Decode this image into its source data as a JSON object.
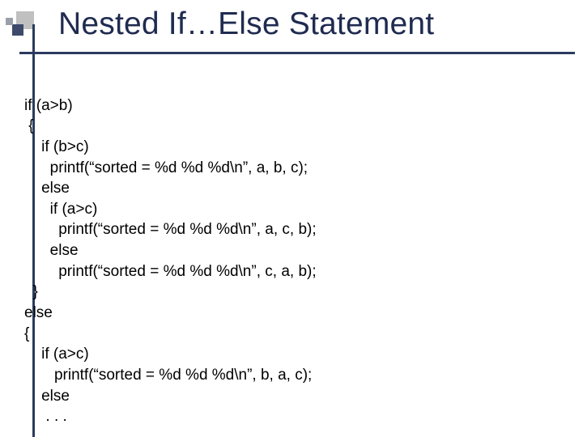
{
  "slide": {
    "title": "Nested If…Else Statement"
  },
  "code": {
    "lines": [
      "if (a>b)",
      " {",
      "    if (b>c)",
      "      printf(“sorted = %d %d %d\\n”, a, b, c);",
      "    else",
      "      if (a>c)",
      "        printf(“sorted = %d %d %d\\n”, a, c, b);",
      "      else",
      "        printf(“sorted = %d %d %d\\n”, c, a, b);",
      "  }",
      "else",
      "{",
      "    if (a>c)",
      "       printf(“sorted = %d %d %d\\n”, b, a, c);",
      "    else",
      "     . . ."
    ]
  }
}
